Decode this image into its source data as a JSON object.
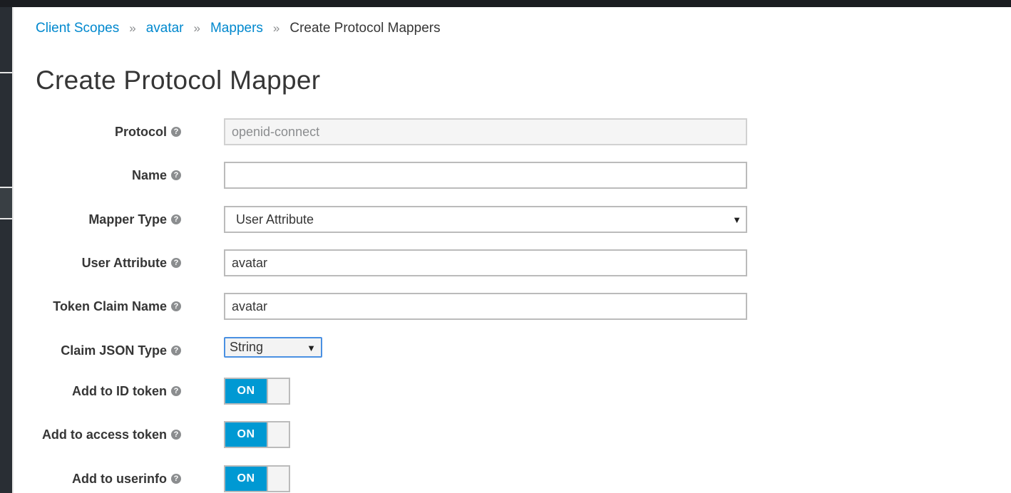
{
  "breadcrumb": {
    "items": [
      {
        "label": "Client Scopes"
      },
      {
        "label": "avatar"
      },
      {
        "label": "Mappers"
      }
    ],
    "current": "Create Protocol Mappers",
    "separator": "»"
  },
  "page_title": "Create Protocol Mapper",
  "form": {
    "protocol": {
      "label": "Protocol",
      "value": "openid-connect"
    },
    "name": {
      "label": "Name",
      "value": ""
    },
    "mapper_type": {
      "label": "Mapper Type",
      "value": "User Attribute"
    },
    "user_attribute": {
      "label": "User Attribute",
      "value": "avatar"
    },
    "token_claim_name": {
      "label": "Token Claim Name",
      "value": "avatar"
    },
    "claim_json_type": {
      "label": "Claim JSON Type",
      "value": "String"
    },
    "add_to_id_token": {
      "label": "Add to ID token",
      "state": "ON"
    },
    "add_to_access_token": {
      "label": "Add to access token",
      "state": "ON"
    },
    "add_to_userinfo": {
      "label": "Add to userinfo",
      "state": "ON"
    }
  },
  "icons": {
    "help": "question-circle-icon",
    "caret": "caret-down-icon"
  },
  "colors": {
    "link": "#0088ce",
    "toggle_on": "#0099d3",
    "select_focus": "#4a90e2"
  }
}
